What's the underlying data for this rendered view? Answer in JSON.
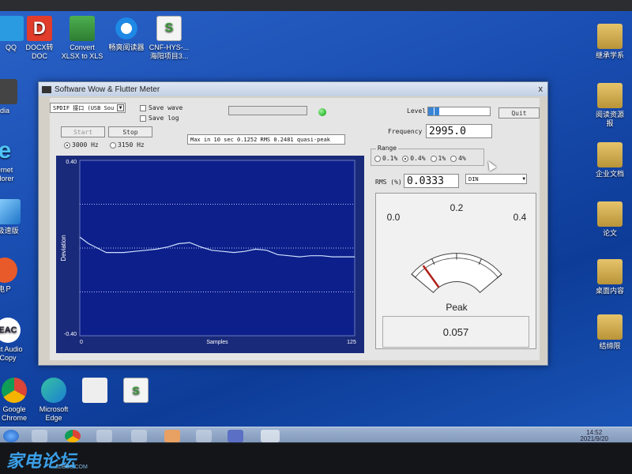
{
  "desktop": {
    "icons_left": [
      {
        "label": "QQ"
      },
      {
        "label": "DOCX转\nDOC"
      },
      {
        "label": "Convert\nXLSX to XLS"
      },
      {
        "label": "畅爽阅读器"
      },
      {
        "label": "CNF-HYS-...\n海阳项目3..."
      }
    ],
    "icons_side": [
      {
        "label": "dia"
      },
      {
        "label": "ernet\nolorer"
      },
      {
        "label": "极速版"
      },
      {
        "label": "电Ｐ"
      },
      {
        "label": "EAC"
      },
      {
        "label": "act Audio\nCopy"
      },
      {
        "label": "Google\nChrome"
      },
      {
        "label": "Microsoft\nEdge"
      }
    ],
    "icons_right": [
      {
        "label": "继承学系"
      },
      {
        "label": "阅读资源\n报"
      },
      {
        "label": "企业文档"
      },
      {
        "label": "论文"
      },
      {
        "label": "桌面内容"
      },
      {
        "label": "结缔限"
      }
    ],
    "taskbar_clock": "14:52\n2021/9/20",
    "watermark": "家电论坛",
    "watermark_url": "JDBBS.COM"
  },
  "window": {
    "title": "Software Wow & Flutter Meter",
    "close": "x",
    "input_select": "SPDIF 接口 (USB Sou",
    "save_wave": "Save wave",
    "save_log": "Save log",
    "start": "Start",
    "stop": "Stop",
    "rate_3000": "3000 Hz",
    "rate_3150": "3150 Hz",
    "status_text": "Max in 10 sec 0.1252 RMS 0.2481 quasi-peak",
    "level_label": "Level",
    "level_fraction": 0.18,
    "quit": "Quit",
    "frequency_label": "Frequency",
    "frequency": "2995.0",
    "range_label": "Range",
    "ranges": [
      "0.1%",
      "0.4%",
      "1%",
      "4%"
    ],
    "range_selected": 1,
    "rms_label": "RMS (%)",
    "rms_value": "0.0333",
    "weighting": "DIN",
    "accent_led": "#3cc23c"
  },
  "meter": {
    "ticks": [
      "0.0",
      "0.2",
      "0.4"
    ],
    "min": 0,
    "max": 0.4,
    "value": 0.057,
    "caption": "Peak",
    "readout": "0.057"
  },
  "chart_data": {
    "type": "line",
    "xlabel": "Samples",
    "ylabel": "Deviation",
    "xlim": [
      0,
      125
    ],
    "ylim": [
      -0.4,
      0.4
    ],
    "x_tick_labels": [
      "0",
      "125"
    ],
    "y_tick_labels": [
      "0.40",
      "-0.40"
    ],
    "grid": "dotted horizontal",
    "series": [
      {
        "x": [
          0,
          4,
          8,
          12,
          16,
          20,
          25,
          30,
          35,
          40,
          45,
          50,
          55,
          60,
          65,
          70,
          75,
          80,
          85,
          90,
          95,
          100,
          105,
          110,
          115,
          120,
          125
        ],
        "values": [
          0.05,
          0.02,
          0.0,
          -0.02,
          -0.02,
          -0.02,
          -0.015,
          -0.01,
          -0.005,
          0.005,
          0.02,
          0.025,
          0.005,
          -0.01,
          -0.015,
          -0.02,
          -0.015,
          -0.005,
          -0.01,
          -0.03,
          -0.035,
          -0.04,
          -0.035,
          -0.035,
          -0.04,
          -0.04,
          -0.04
        ]
      }
    ]
  }
}
